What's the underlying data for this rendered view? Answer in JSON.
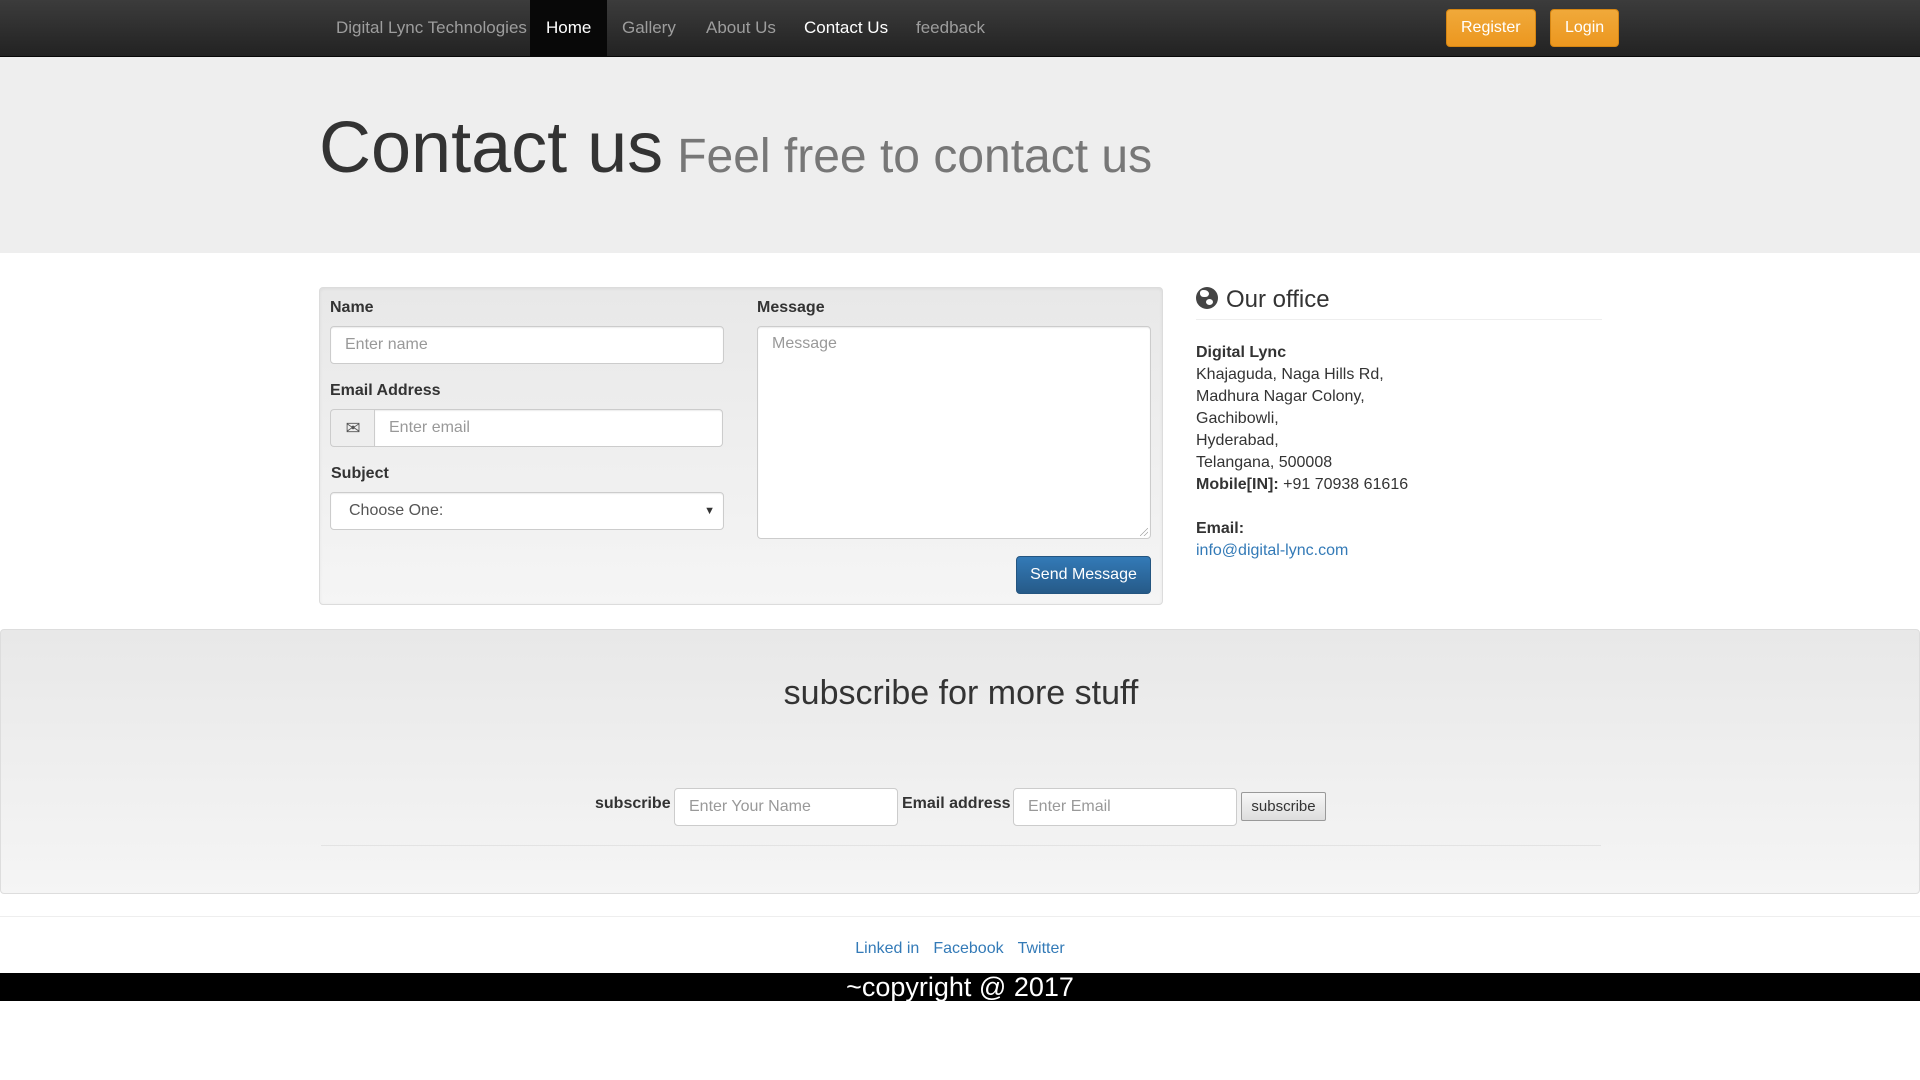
{
  "navbar": {
    "brand": "Digital Lync Technologies",
    "items": [
      {
        "label": "Home"
      },
      {
        "label": "Gallery"
      },
      {
        "label": "About Us"
      },
      {
        "label": "Contact Us"
      },
      {
        "label": "feedback"
      }
    ],
    "register_label": "Register",
    "login_label": "Login"
  },
  "jumbotron": {
    "title": "Contact us",
    "subtitle": "Feel free to contact us"
  },
  "form": {
    "name_label": "Name",
    "name_placeholder": "Enter name",
    "email_label": "Email Address",
    "email_placeholder": "Enter email",
    "subject_label": "Subject",
    "subject_value": "Choose One:",
    "message_label": "Message",
    "message_placeholder": "Message",
    "send_label": "Send Message",
    "email_icon": "envelope-icon"
  },
  "office": {
    "heading": "Our office",
    "icon": "globe-icon",
    "company": "Digital Lync",
    "address_lines": [
      "Khajaguda, Naga Hills Rd,",
      "Madhura Nagar Colony,",
      "Gachibowli,",
      "Hyderabad,",
      "Telangana, 500008"
    ],
    "mobile_label": "Mobile[IN]:",
    "mobile_value": "+91 70938 61616",
    "email_label": "Email:",
    "email_value": "info@digital-lync.com"
  },
  "subscribe": {
    "title": "subscribe for more stuff",
    "name_label": "subscribe",
    "name_placeholder": "Enter Your Name",
    "email_label": "Email address",
    "email_placeholder": "Enter Email",
    "button_label": "subscribe"
  },
  "footer": {
    "links": [
      "Linked in",
      "Facebook",
      "Twitter"
    ],
    "copyright": "~copyright @ 2017"
  },
  "colors": {
    "accent": "#337ab7",
    "warning": "#ec971f",
    "navbar": "#222222"
  }
}
